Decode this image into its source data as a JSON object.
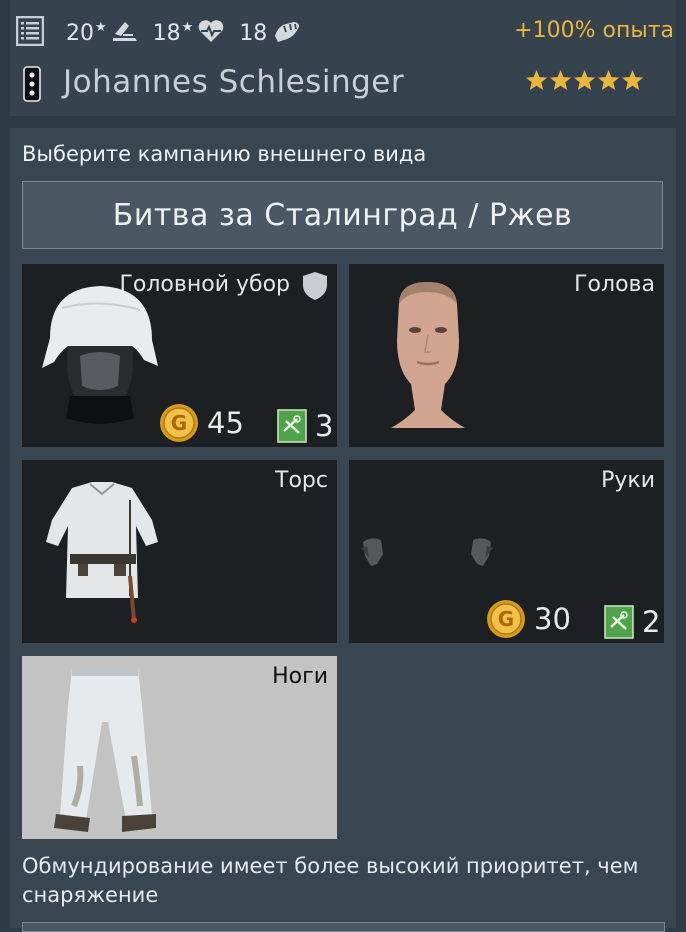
{
  "header": {
    "stats": [
      {
        "value": "20",
        "star": "★",
        "icon": "skill-icon"
      },
      {
        "value": "18",
        "star": "★",
        "icon": "health-icon"
      },
      {
        "value": "18",
        "star": "",
        "icon": "strength-icon"
      }
    ],
    "xp_bonus": "+100% опыта",
    "player_name": "Johannes Schlesinger",
    "rating_stars": 5
  },
  "customization": {
    "prompt": "Выберите кампанию внешнего вида",
    "campaign": "Битва за Сталинград / Ржев",
    "slots": {
      "headgear": {
        "label": "Головной убор",
        "gold": "45",
        "tickets": "3"
      },
      "head": {
        "label": "Голова"
      },
      "torso": {
        "label": "Торс"
      },
      "hands": {
        "label": "Руки",
        "gold": "30",
        "tickets": "2"
      },
      "legs": {
        "label": "Ноги"
      }
    },
    "note": "Обмундирование имеет более высокий приоритет, чем снаряжение"
  },
  "colors": {
    "accent_gold": "#e8b73c",
    "background": "#2e3a44",
    "slot_dark": "#1d2023"
  }
}
